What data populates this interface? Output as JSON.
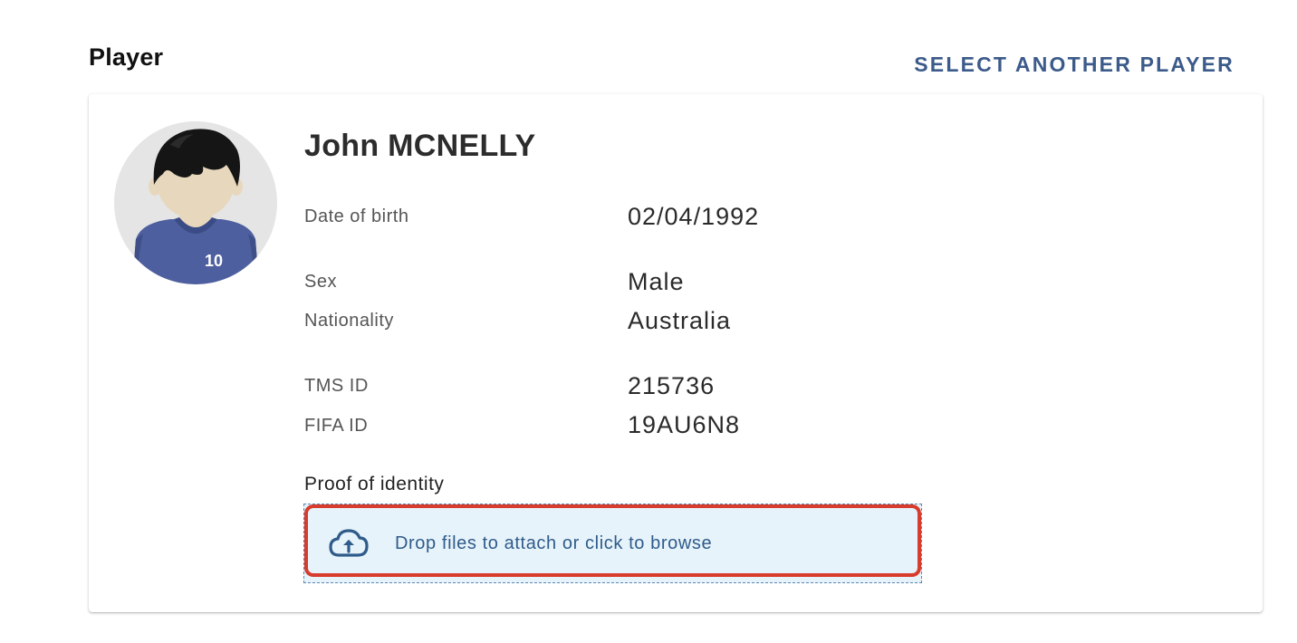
{
  "section": {
    "title": "Player",
    "select_another_label": "SELECT ANOTHER PLAYER"
  },
  "player": {
    "avatar_number": "10",
    "name": "John MCNELLY",
    "fields": {
      "dob_label": "Date of birth",
      "dob_value": "02/04/1992",
      "sex_label": "Sex",
      "sex_value": "Male",
      "nationality_label": "Nationality",
      "nationality_value": "Australia",
      "tms_label": "TMS ID",
      "tms_value": "215736",
      "fifa_label": "FIFA ID",
      "fifa_value": "19AU6N8"
    }
  },
  "proof": {
    "label": "Proof of identity",
    "dropzone_text": "Drop files to attach or click to browse",
    "icon": "cloud-upload-icon"
  },
  "colors": {
    "accent": "#3c5b8a",
    "dropzone_bg": "#e7f3fa",
    "highlight": "#d83c2c",
    "jersey": "#4d5f9e"
  }
}
